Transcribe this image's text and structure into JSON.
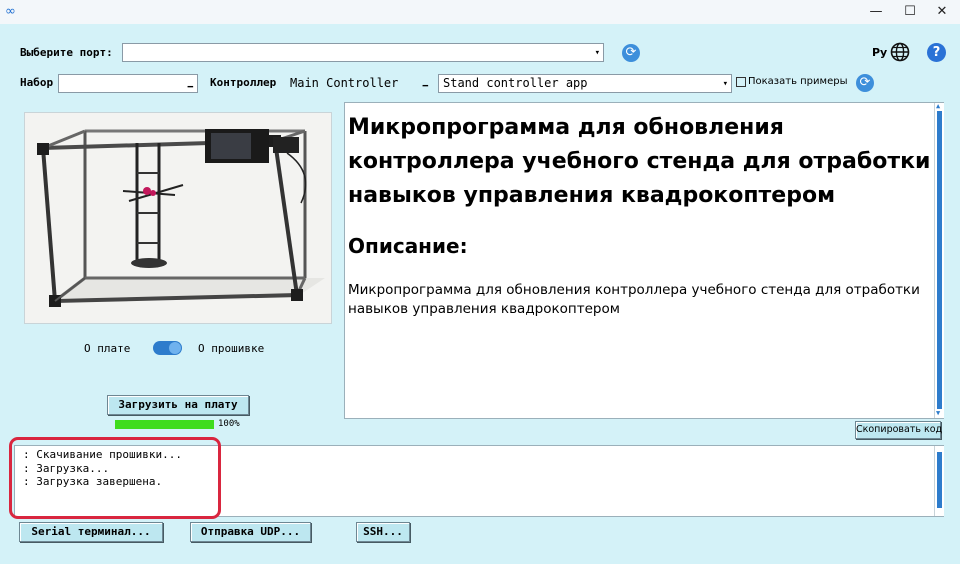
{
  "titlebar": {
    "app_icon": "link-icon",
    "minimize": "—",
    "maximize": "☐",
    "close": "✕"
  },
  "port": {
    "label": "Выберите порт:",
    "value": "",
    "dropdown": "▾"
  },
  "language": {
    "label": "Ру",
    "icon": "globe-icon"
  },
  "help_icon": "help-icon",
  "kit": {
    "label": "Набор",
    "value": "",
    "dropdown": "▁"
  },
  "controller": {
    "label": "Контроллер",
    "value": "Main Controller",
    "dropdown": "▁",
    "app_value": "Stand controller app",
    "app_dropdown": "▾"
  },
  "show_examples": {
    "label": "Показать примеры",
    "checked": false
  },
  "toggle": {
    "left_label": "О плате",
    "right_label": "О прошивке",
    "state": "right"
  },
  "upload": {
    "button_label": "Загрузить на плату",
    "progress_text": "100%",
    "progress_value": 1.0
  },
  "description": {
    "title": "Микропрограмма для обновления контроллера учебного стенда для отработки навыков управления квадрокоптером",
    "subtitle": "Описание:",
    "body": "Микропрограмма для обновления контроллера учебного стенда для отработки навыков управления квадрокоптером"
  },
  "copy_button": "Скопировать код",
  "log": {
    "lines": [
      ": Скачивание прошивки...",
      ": Загрузка...",
      "",
      ": Загрузка завершена."
    ]
  },
  "bottom_buttons": {
    "serial": "Serial терминал...",
    "udp": "Отправка UDP...",
    "ssh": "SSH..."
  },
  "colors": {
    "background": "#d4f2f8",
    "progress": "#3fdc1e",
    "scroll_thumb": "#2d7ccc",
    "highlight": "#d9263f"
  }
}
